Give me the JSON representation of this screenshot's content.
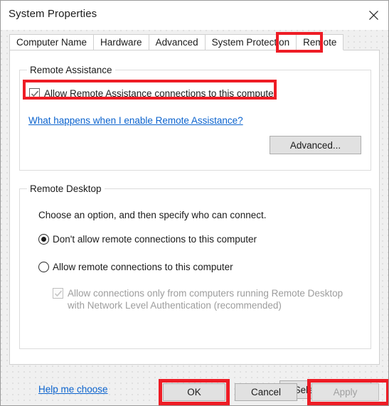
{
  "window": {
    "title": "System Properties",
    "close_icon": "close-icon"
  },
  "tabs": [
    {
      "label": "Computer Name",
      "active": false
    },
    {
      "label": "Hardware",
      "active": false
    },
    {
      "label": "Advanced",
      "active": false
    },
    {
      "label": "System Protection",
      "active": false
    },
    {
      "label": "Remote",
      "active": true
    }
  ],
  "remote_assistance": {
    "group_title": "Remote Assistance",
    "checkbox_label": "Allow Remote Assistance connections to this computer",
    "checkbox_checked": true,
    "link_label": "What happens when I enable Remote Assistance?",
    "advanced_button": "Advanced..."
  },
  "remote_desktop": {
    "group_title": "Remote Desktop",
    "instruction": "Choose an option, and then specify who can connect.",
    "option_deny": "Don't allow remote connections to this computer",
    "option_allow": "Allow remote connections to this computer",
    "selected_option": "option_deny",
    "nla_label": "Allow connections only from computers running Remote Desktop with Network Level Authentication (recommended)",
    "nla_checked": true,
    "nla_disabled": true,
    "help_link": "Help me choose",
    "select_users_button": "Select Users..."
  },
  "actions": {
    "ok": "OK",
    "cancel": "Cancel",
    "apply": "Apply",
    "apply_disabled": true
  },
  "highlights": {
    "color": "#ee1c25",
    "targets": [
      "remote-tab",
      "allow-remote-assistance-checkbox",
      "ok-button",
      "apply-button"
    ]
  }
}
